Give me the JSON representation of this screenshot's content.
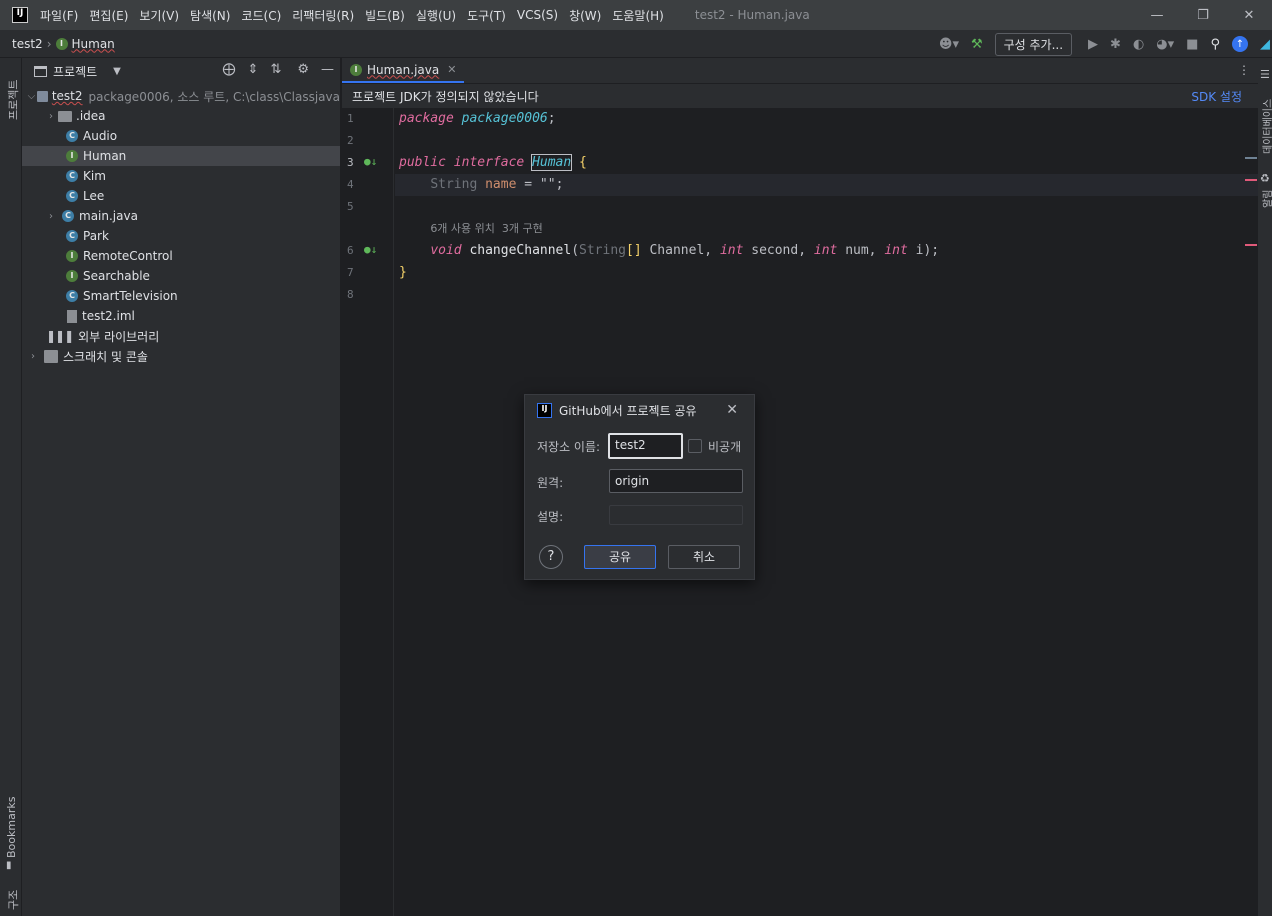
{
  "menu": {
    "items": [
      "파일(F)",
      "편집(E)",
      "보기(V)",
      "탐색(N)",
      "코드(C)",
      "리팩터링(R)",
      "빌드(B)",
      "실행(U)",
      "도구(T)",
      "VCS(S)",
      "창(W)",
      "도움말(H)"
    ],
    "window_title": "test2 - Human.java"
  },
  "breadcrumb": {
    "project": "test2",
    "file": "Human"
  },
  "toolbar": {
    "config_label": "구성 추가..."
  },
  "left_stripe": {
    "project_label": "프로젝트",
    "bookmarks_label": "Bookmarks",
    "structure_label": "구조"
  },
  "project_panel": {
    "title": "프로젝트",
    "root": {
      "name": "test2",
      "detail": "package0006, 소스 루트, C:\\class\\Classjava"
    },
    "items": [
      {
        "label": ".idea",
        "kind": "folder"
      },
      {
        "label": "Audio",
        "kind": "class"
      },
      {
        "label": "Human",
        "kind": "interface"
      },
      {
        "label": "Kim",
        "kind": "class"
      },
      {
        "label": "Lee",
        "kind": "class"
      },
      {
        "label": "main.java",
        "kind": "class"
      },
      {
        "label": "Park",
        "kind": "class"
      },
      {
        "label": "RemoteControl",
        "kind": "interface"
      },
      {
        "label": "Searchable",
        "kind": "interface"
      },
      {
        "label": "SmartTelevision",
        "kind": "class"
      },
      {
        "label": "test2.iml",
        "kind": "file"
      }
    ],
    "external_libraries": "외부 라이브러리",
    "scratches": "스크래치 및 콘솔"
  },
  "editor": {
    "tab_name": "Human.java",
    "jdk_banner": "프로젝트 JDK가 정의되지 않았습니다",
    "jdk_link": "SDK 설정",
    "line_numbers": [
      "1",
      "2",
      "3",
      "4",
      "5",
      "6",
      "7",
      "8"
    ],
    "code": {
      "package_kw": "package",
      "package_name": "package0006",
      "public_kw": "public",
      "interface_kw": "interface",
      "iface_name": "Human",
      "string_type": "String",
      "field_name": "name",
      "field_value": "\"\"",
      "usage_hint": "6개 사용 위치  3개 구현",
      "void_kw": "void",
      "method_name": "changeChannel",
      "param1": "Channel",
      "int_kw": "int",
      "param2": "second",
      "param3": "num",
      "param4": "i"
    }
  },
  "right_stripe": {
    "db_label": "데이터베이스",
    "notif_label": "알림"
  },
  "dialog": {
    "title": "GitHub에서 프로젝트 공유",
    "repo_label": "저장소 이름:",
    "repo_value": "test2",
    "private_label": "비공개",
    "remote_label": "원격:",
    "remote_value": "origin",
    "desc_label": "설명:",
    "desc_value": "",
    "help": "?",
    "share_button": "공유",
    "cancel_button": "취소"
  }
}
